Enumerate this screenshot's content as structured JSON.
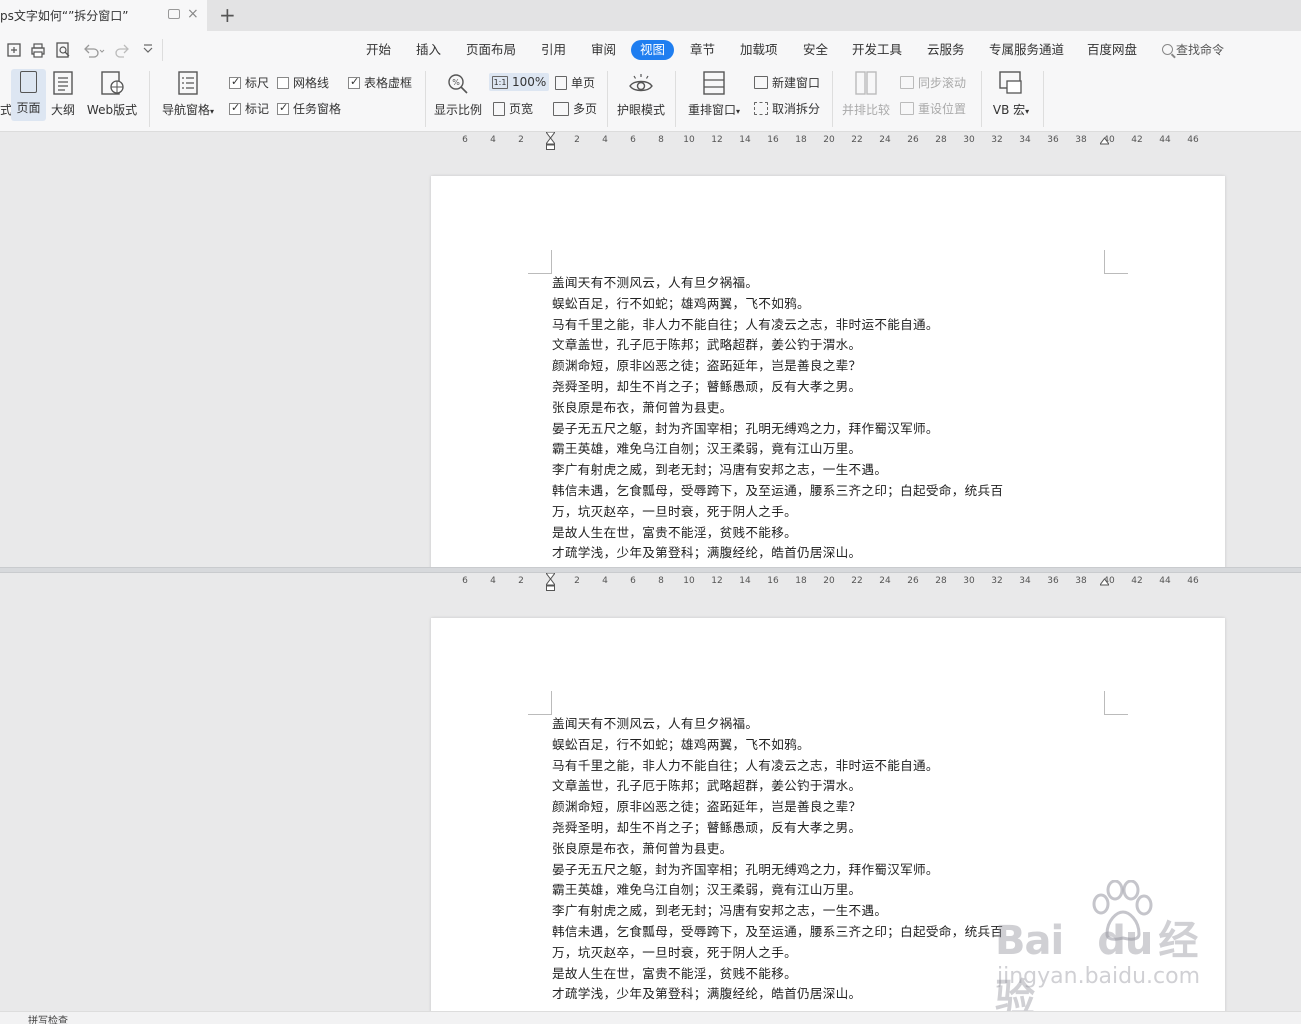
{
  "window": {
    "tab_title": "ps文字如何“”拆分窗口”",
    "new_tab_glyph": "+",
    "close_glyph": "×"
  },
  "menu": {
    "items": [
      "开始",
      "插入",
      "页面布局",
      "引用",
      "审阅",
      "视图",
      "章节",
      "加载项",
      "安全",
      "开发工具",
      "云服务",
      "专属服务通道",
      "百度网盘"
    ],
    "active": "视图",
    "search_label": "查找命令"
  },
  "toolbar": {
    "cut_off_label": "式",
    "page_view": "页面",
    "outline_view": "大纲",
    "web_view": "Web版式",
    "nav_pane": "导航窗格",
    "ruler": "标尺",
    "gridlines": "网格线",
    "table_gridlines": "表格虚框",
    "marks": "标记",
    "task_pane": "任务窗格",
    "zoom": "显示比例",
    "zoom_100": "100%",
    "page_width": "页宽",
    "single_page": "单页",
    "multi_page": "多页",
    "eye_protection": "护眼模式",
    "rearrange": "重排窗口",
    "new_window": "新建窗口",
    "cancel_split": "取消拆分",
    "side_by_side": "并排比较",
    "sync_scroll": "同步滚动",
    "reset_position": "重设位置",
    "vb_macro": "VB 宏"
  },
  "checkboxes": {
    "ruler": true,
    "gridlines": false,
    "table_gridlines": true,
    "marks": true,
    "task_pane": true
  },
  "ruler": {
    "ticks": [
      "6",
      "4",
      "2",
      "2",
      "4",
      "6",
      "8",
      "10",
      "12",
      "14",
      "16",
      "18",
      "20",
      "22",
      "24",
      "26",
      "28",
      "30",
      "32",
      "34",
      "36",
      "38",
      "40",
      "42",
      "44",
      "46"
    ]
  },
  "document": {
    "lines": [
      "盖闻天有不测风云，人有旦夕祸福。",
      "蜈蚣百足，行不如蛇；雄鸡两翼，飞不如鸦。",
      "马有千里之能，非人力不能自往；人有凌云之志，非时运不能自通。",
      "文章盖世，孔子厄于陈邦；武略超群，姜公钓于渭水。",
      "颜渊命短，原非凶恶之徒；盗跖延年，岂是善良之辈？",
      "尧舜圣明，却生不肖之子；瞽鲧愚顽，反有大孝之男。",
      "张良原是布衣，萧何曾为县吏。",
      "晏子无五尺之躯，封为齐国宰相；孔明无缚鸡之力，拜作蜀汉军师。",
      "霸王英雄，难免乌江自刎；汉王柔弱，竟有江山万里。",
      "李广有射虎之威，到老无封；冯唐有安邦之志，一生不遇。",
      "韩信未遇，乞食瓢母，受辱跨下，及至运通，腰系三齐之印；白起受命，统兵百",
      "万，坑灭赵卒，一旦时衰，死于阴人之手。",
      "是故人生在世，富贵不能淫，贫贱不能移。",
      "才疏学浅，少年及第登科；满腹经纶，皓首仍居深山。"
    ]
  },
  "watermark": {
    "brand": "Bai",
    "brand2": "du",
    "brand_cn": "经验",
    "url": "jingyan.baidu.com"
  },
  "statusbar": {
    "left": "拼写检查"
  }
}
